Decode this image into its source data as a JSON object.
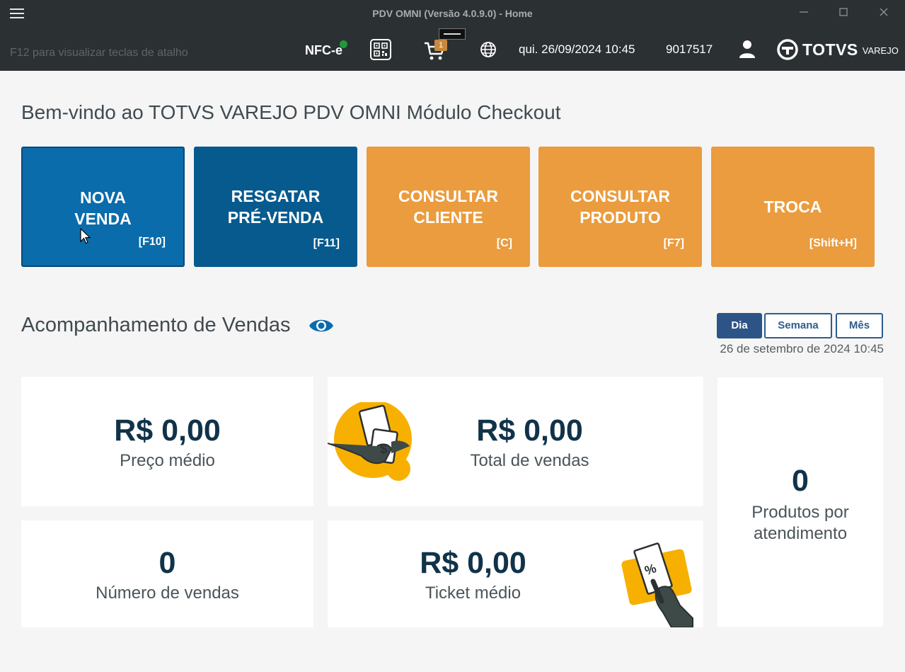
{
  "window": {
    "title": "PDV OMNI (Versão 4.0.9.0) - Home",
    "controls": [
      "minimize",
      "maximize",
      "close"
    ]
  },
  "toolbar": {
    "shortcut_hint": "F12 para visualizar teclas de atalho",
    "nfce_label": "NFC-e",
    "nfce_status_color": "#1f9a3a",
    "cart_count": "1",
    "datetime": "qui. 26/09/2024 10:45",
    "terminal_id": "9017517",
    "logo_text": "TOTVS",
    "logo_sub": "VAREJO"
  },
  "main": {
    "welcome": "Bem-vindo ao TOTVS VAREJO PDV OMNI Módulo Checkout",
    "actions": [
      {
        "label": "NOVA VENDA",
        "line1": "NOVA",
        "line2": "VENDA",
        "key": "[F10]",
        "color": "#0a6cab"
      },
      {
        "label": "RESGATAR PRÉ-VENDA",
        "line1": "RESGATAR",
        "line2": "PRÉ-VENDA",
        "key": "[F11]",
        "color": "#075a8e"
      },
      {
        "label": "CONSULTAR CLIENTE",
        "line1": "CONSULTAR",
        "line2": "CLIENTE",
        "key": "[C]",
        "color": "#ea9c3e"
      },
      {
        "label": "CONSULTAR PRODUTO",
        "line1": "CONSULTAR",
        "line2": "PRODUTO",
        "key": "[F7]",
        "color": "#ea9c3e"
      },
      {
        "label": "TROCA",
        "line1": "TROCA",
        "line2": "",
        "key": "[Shift+H]",
        "color": "#ea9c3e"
      }
    ],
    "sales_section": {
      "title": "Acompanhamento de Vendas",
      "periods": [
        "Dia",
        "Semana",
        "Mês"
      ],
      "active_period": "Dia",
      "date": "26 de setembro de 2024 10:45"
    },
    "metrics": {
      "preco_medio": {
        "value": "R$ 0,00",
        "label": "Preço médio"
      },
      "total_vendas": {
        "value": "R$ 0,00",
        "label": "Total de vendas"
      },
      "produtos_atendimento": {
        "value": "0",
        "label_line1": "Produtos por",
        "label_line2": "atendimento"
      },
      "numero_vendas": {
        "value": "0",
        "label": "Número de vendas"
      },
      "ticket_medio": {
        "value": "R$ 0,00",
        "label": "Ticket médio"
      }
    }
  },
  "colors": {
    "topbar": "#2b3032",
    "accent_blue": "#2d5486",
    "accent_orange": "#ea9c3e",
    "illustration_yellow": "#f7b000",
    "metric_value": "#11334a"
  }
}
